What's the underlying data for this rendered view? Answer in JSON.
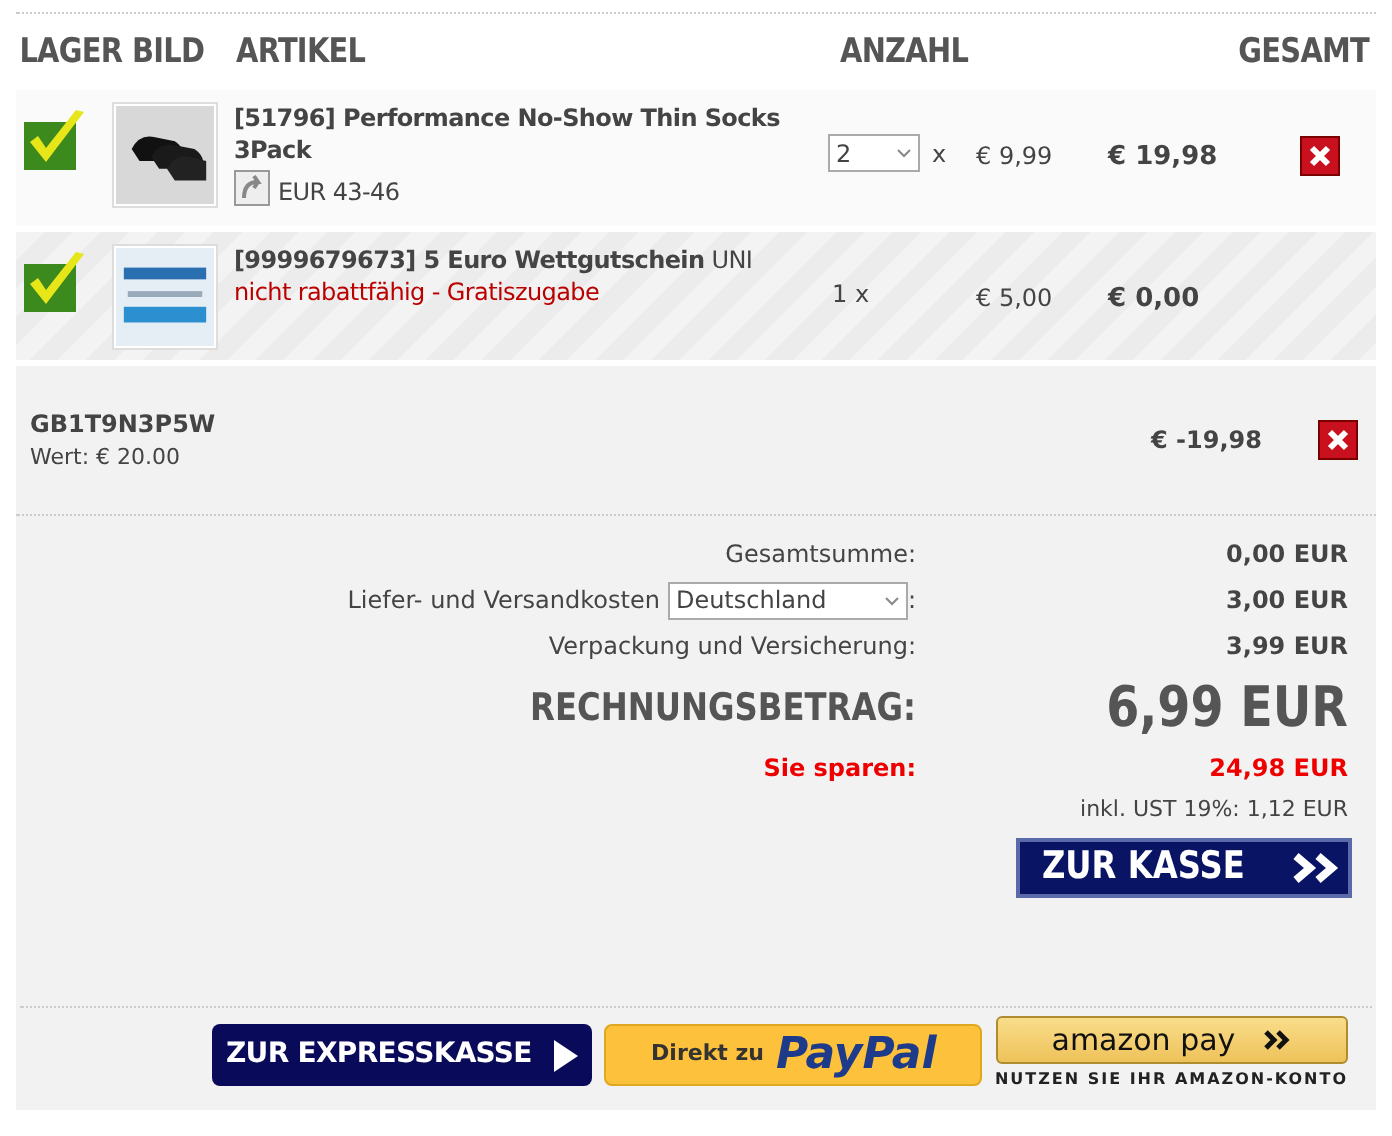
{
  "columns": [
    {
      "label": "LAGER"
    },
    {
      "label": "BILD"
    },
    {
      "label": "ARTIKEL"
    },
    {
      "label": "ANZAHL"
    },
    {
      "label": "GESAMT"
    }
  ],
  "items": [
    {
      "in_stock": true,
      "kind": "select",
      "title": "[51796] Performance No-Show Thin Socks 3Pack",
      "size": "EUR 43-46",
      "quantity": "2",
      "times": "x",
      "price": "€ 9,99",
      "total": "€ 19,98",
      "removable": true
    },
    {
      "in_stock": true,
      "kind": "fixed",
      "title": "[9999679673] 5 Euro Wettgutschein",
      "suffix": "UNI",
      "note": "nicht rabattfähig - Gratiszugabe",
      "quantity": "1 x",
      "price": "€ 5,00",
      "total": "€ 0,00",
      "removable": false
    }
  ],
  "coupon": {
    "code": "GB1T9N3P5W",
    "value": "Wert: € 20.00",
    "amount": "€ -19,98",
    "removable": true
  },
  "summary": {
    "subtotal_label": "Gesamtsumme:",
    "subtotal": "0,00 EUR",
    "shipping_label": "Liefer- und Versandkosten",
    "shipping_country": "Deutschland",
    "shipping_colon": ":",
    "shipping": "3,00 EUR",
    "packaging_label": "Verpackung und Versicherung:",
    "packaging": "3,99 EUR",
    "total_label": "RECHNUNGSBETRAG:",
    "total": "6,99 EUR",
    "savings_label": "Sie sparen:",
    "savings": "24,98 EUR",
    "vat": "inkl. UST 19%: 1,12 EUR"
  },
  "checkout_button": "ZUR KASSE",
  "express_button": "ZUR EXPRESSKASSE",
  "paypal": {
    "prefix": "Direkt zu",
    "logo": "PayPal"
  },
  "amazon": {
    "logo": "amazon pay",
    "caption": "NUTZEN SIE IHR AMAZON-KONTO"
  }
}
